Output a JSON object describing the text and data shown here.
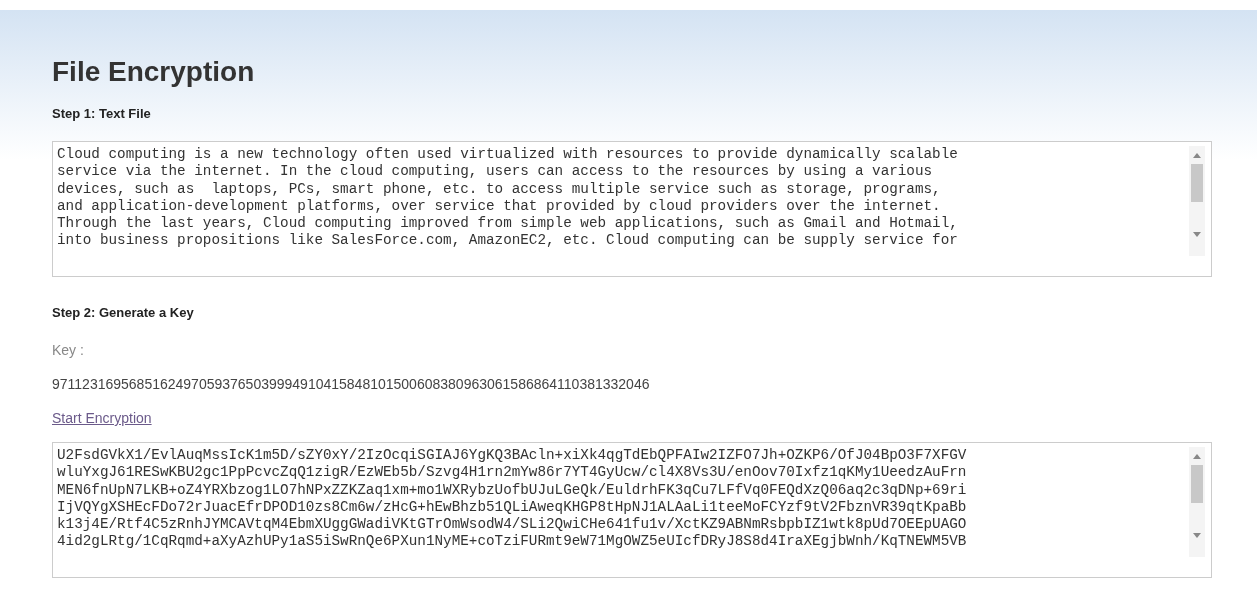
{
  "title": "File Encryption",
  "step1": {
    "heading": "Step 1: Text File",
    "text_lines": [
      "Cloud computing is a new technology often used virtualized with resources to provide dynamically scalable",
      "service via the internet. In the cloud computing, users can access to the resources by using a various",
      "devices, such as  laptops, PCs, smart phone, etc. to access multiple service such as storage, programs,",
      "and application-development platforms, over service that provided by cloud providers over the internet.",
      "Through the last years, Cloud computing improved from simple web applications, such as Gmail and Hotmail,",
      "into business propositions like SalesForce.com, AmazonEC2, etc. Cloud computing can be supply service for"
    ]
  },
  "step2": {
    "heading": "Step 2: Generate a Key",
    "key_label": "Key :",
    "key_value": "97112316956851624970593765039994910415848101500608380963061586864110381332046",
    "link": "Start Encryption",
    "cipher_lines": [
      "U2FsdGVkX1/EvlAuqMssIcK1m5D/sZY0xY/2IzOcqiSGIAJ6YgKQ3BAcln+xiXk4qgTdEbQPFAIw2IZFO7Jh+OZKP6/OfJ04BpO3F7XFGV",
      "wluYxgJ61RESwKBU2gc1PpPcvcZqQ1zigR/EzWEb5b/Szvg4H1rn2mYw86r7YT4GyUcw/cl4X8Vs3U/enOov70Ixfz1qKMy1UeedzAuFrn",
      "MEN6fnUpN7LKB+oZ4YRXbzog1LO7hNPxZZKZaq1xm+mo1WXRybzUofbUJuLGeQk/EuldrhFK3qCu7LFfVq0FEQdXzQ06aq2c3qDNp+69ri",
      "IjVQYgXSHEcFDo72rJuacEfrDPOD10zs8Cm6w/zHcG+hEwBhzb51QLiAweqKHGP8tHpNJ1ALAaLi1teeMoFCYzf9tV2FbznVR39qtKpaBb",
      "k13j4E/Rtf4C5zRnhJYMCAVtqM4EbmXUggGWadiVKtGTrOmWsodW4/SLi2QwiCHe641fu1v/XctKZ9ABNmRsbpbIZ1wtk8pUd7OEEpUAGO",
      "4id2gLRtg/1CqRqmd+aXyAzhUPy1aS5iSwRnQe6PXun1NyME+coTziFURmt9eW71MgOWZ5eUIcfDRyJ8S8d4IraXEgjbWnh/KqTNEWM5VB"
    ]
  }
}
